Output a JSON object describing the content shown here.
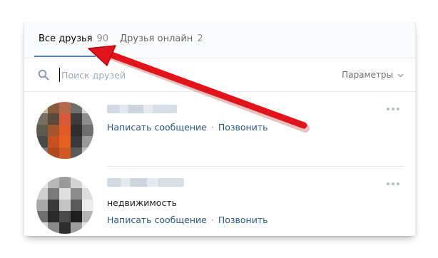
{
  "tabs": [
    {
      "label": "Все друзья",
      "count": "90"
    },
    {
      "label": "Друзья онлайн",
      "count": "2"
    }
  ],
  "search": {
    "placeholder": "Поиск друзей"
  },
  "params_label": "Параметры",
  "friends": [
    {
      "name_visible": false,
      "subtitle": "",
      "actions": [
        "Написать сообщение",
        "Позвонить"
      ]
    },
    {
      "name_visible": false,
      "subtitle": "недвижимость",
      "actions": [
        "Написать сообщение",
        "Позвонить"
      ]
    }
  ],
  "colors": {
    "accent": "#5181b8",
    "link": "#2a5885",
    "annotation_arrow": "#e0141a"
  },
  "icons": {
    "search": "search-icon",
    "params_chevron": "chevron-down-icon",
    "more": "more-dots-icon"
  }
}
